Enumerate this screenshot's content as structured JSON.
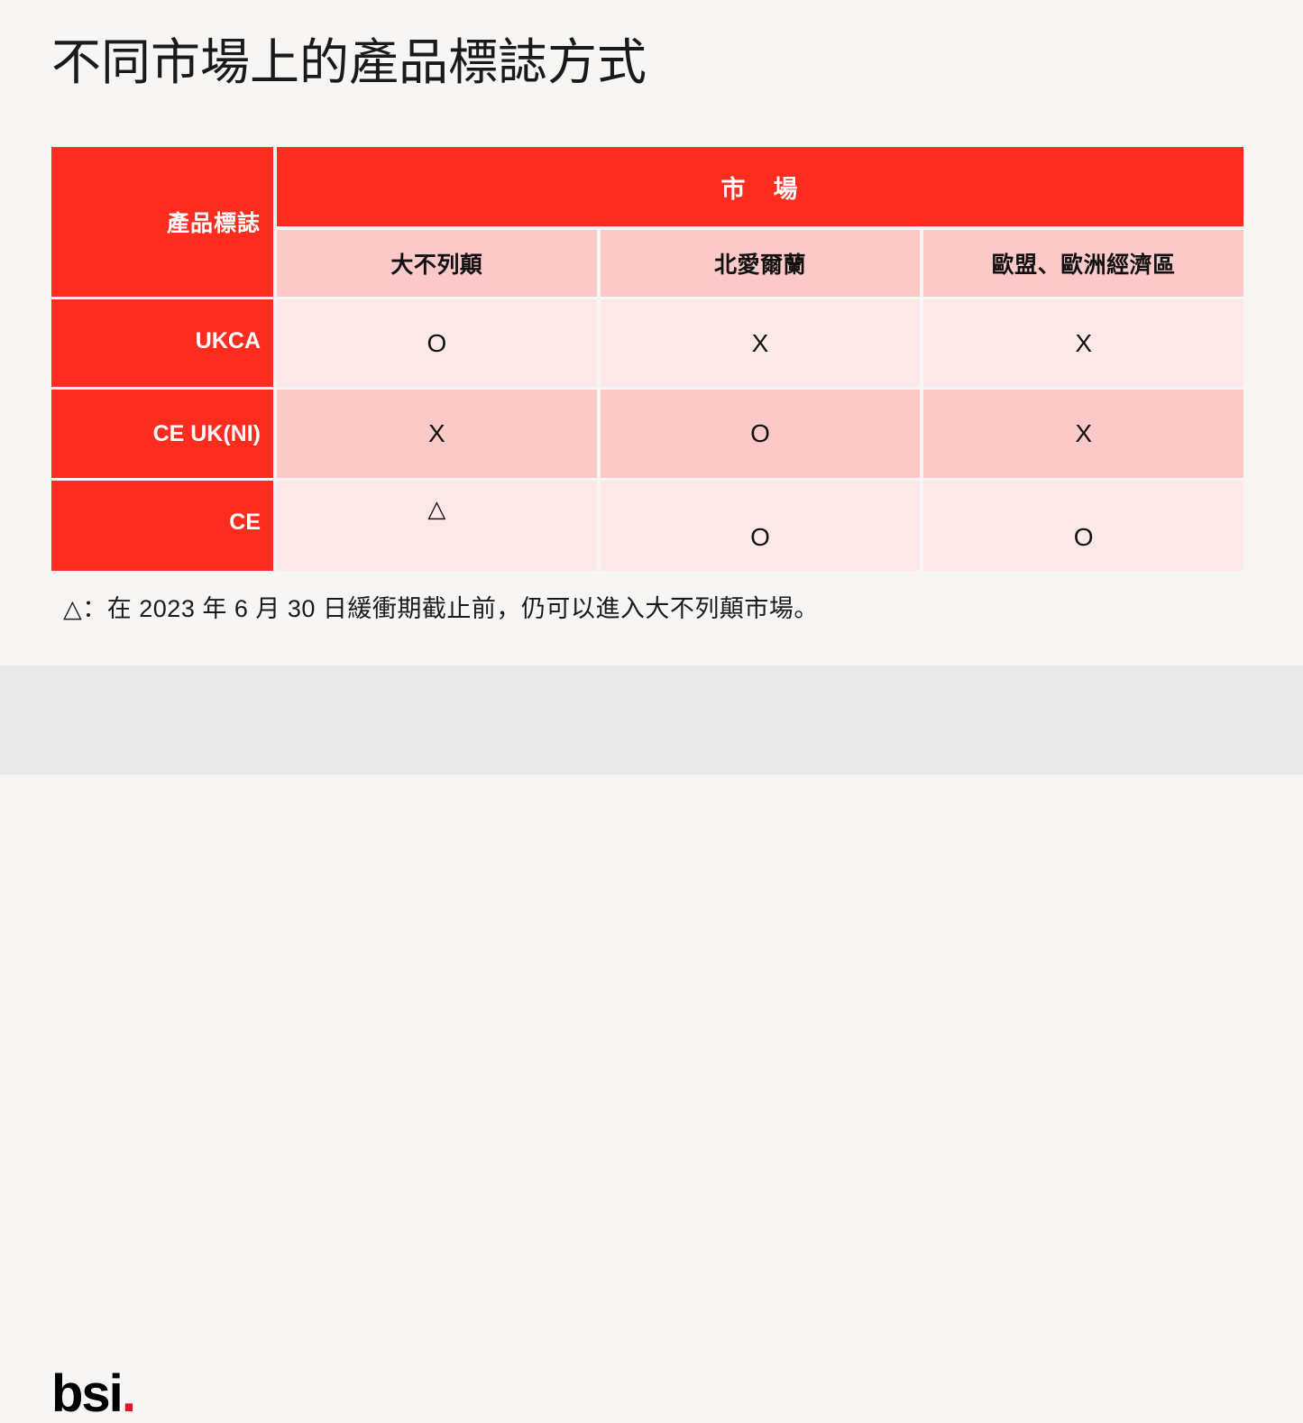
{
  "title": "不同市場上的產品標誌方式",
  "table": {
    "corner_label": "產品標誌",
    "market_group_header": "市　場",
    "market_columns": [
      "大不列顛",
      "北愛爾蘭",
      "歐盟、歐洲經濟區"
    ],
    "rows": [
      {
        "label": "UKCA",
        "cells": [
          "O",
          "X",
          "X"
        ]
      },
      {
        "label": "CE UK(NI)",
        "cells": [
          "X",
          "O",
          "X"
        ]
      },
      {
        "label": "CE",
        "cells": [
          "△",
          "O",
          "O"
        ]
      }
    ]
  },
  "footnote": "△：在 2023 年 6 月 30 日緩衝期截止前，仍可以進入大不列顛市場。",
  "footer": {
    "logo_text": "bsi",
    "logo_dot": "."
  },
  "colors": {
    "brand_red": "#fc2d1f",
    "pink_dark": "#fcc9c9",
    "pink_light": "#fde8e8",
    "page_background": "#f7f6f4",
    "footer_background": "#e9e9e9",
    "logo_dot_red": "#e8112d"
  }
}
